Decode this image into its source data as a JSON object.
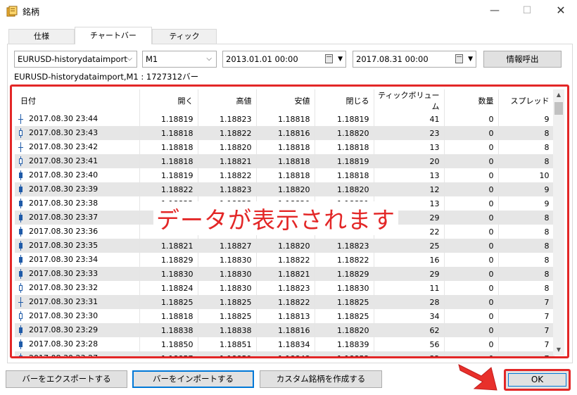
{
  "window": {
    "title": "銘柄",
    "minimize": "—",
    "maximize": "☐",
    "close": "✕"
  },
  "tabs": [
    "仕様",
    "チャートバー",
    "ティック"
  ],
  "controls": {
    "symbol": "EURUSD-historydataimport",
    "timeframe": "M1",
    "date_from": "2013.01.01 00:00",
    "date_to": "2017.08.31 00:00",
    "request_button": "情報呼出"
  },
  "info_line": "EURUSD-historydataimport,M1 : 1727312バー",
  "table": {
    "headers": [
      "日付",
      "開く",
      "高値",
      "安値",
      "閉じる",
      "ティックボリューム",
      "数量",
      "スプレッド"
    ],
    "rows": [
      [
        "2017.08.30 23:44",
        "1.18819",
        "1.18823",
        "1.18818",
        "1.18819",
        "41",
        "0",
        "9"
      ],
      [
        "2017.08.30 23:43",
        "1.18818",
        "1.18822",
        "1.18816",
        "1.18820",
        "23",
        "0",
        "8"
      ],
      [
        "2017.08.30 23:42",
        "1.18818",
        "1.18820",
        "1.18818",
        "1.18818",
        "13",
        "0",
        "8"
      ],
      [
        "2017.08.30 23:41",
        "1.18818",
        "1.18821",
        "1.18818",
        "1.18819",
        "20",
        "0",
        "8"
      ],
      [
        "2017.08.30 23:40",
        "1.18819",
        "1.18822",
        "1.18818",
        "1.18818",
        "13",
        "0",
        "10"
      ],
      [
        "2017.08.30 23:39",
        "1.18822",
        "1.18823",
        "1.18820",
        "1.18820",
        "12",
        "0",
        "9"
      ],
      [
        "2017.08.30 23:38",
        "1.18822",
        "1.18823",
        "1.18820",
        "1.18821",
        "13",
        "0",
        "9"
      ],
      [
        "2017.08.30 23:37",
        "1.18824",
        "",
        "",
        "",
        "29",
        "0",
        "8"
      ],
      [
        "2017.08.30 23:36",
        "1.18824",
        "",
        "",
        "",
        "22",
        "0",
        "8"
      ],
      [
        "2017.08.30 23:35",
        "1.18821",
        "1.18827",
        "1.18820",
        "1.18823",
        "25",
        "0",
        "8"
      ],
      [
        "2017.08.30 23:34",
        "1.18829",
        "1.18830",
        "1.18822",
        "1.18822",
        "16",
        "0",
        "8"
      ],
      [
        "2017.08.30 23:33",
        "1.18830",
        "1.18830",
        "1.18821",
        "1.18829",
        "29",
        "0",
        "8"
      ],
      [
        "2017.08.30 23:32",
        "1.18824",
        "1.18830",
        "1.18823",
        "1.18830",
        "11",
        "0",
        "8"
      ],
      [
        "2017.08.30 23:31",
        "1.18825",
        "1.18825",
        "1.18822",
        "1.18825",
        "28",
        "0",
        "7"
      ],
      [
        "2017.08.30 23:30",
        "1.18818",
        "1.18825",
        "1.18813",
        "1.18825",
        "34",
        "0",
        "7"
      ],
      [
        "2017.08.30 23:29",
        "1.18838",
        "1.18838",
        "1.18816",
        "1.18820",
        "62",
        "0",
        "7"
      ],
      [
        "2017.08.30 23:28",
        "1.18850",
        "1.18851",
        "1.18834",
        "1.18839",
        "56",
        "0",
        "7"
      ],
      [
        "2017.08.30 23:27",
        "1.18857",
        "1.18859",
        "1.18848",
        "1.18852",
        "32",
        "0",
        "7"
      ]
    ],
    "candles": [
      "doji",
      "hollow",
      "doji",
      "hollow",
      "fill",
      "fill",
      "fill",
      "fill",
      "fill",
      "fill",
      "fill",
      "fill",
      "hollow",
      "doji",
      "hollow",
      "fill",
      "fill",
      "fill"
    ]
  },
  "overlay_text": "データが表示されます",
  "buttons": {
    "export": "バーをエクスポートする",
    "import": "バーをインポートする",
    "custom": "カスタム銘柄を作成する",
    "ok": "OK"
  },
  "colors": {
    "highlight": "#e32727",
    "focus": "#0078d7",
    "candle": "#1e5aa8",
    "row_alt": "#e6e6e6"
  }
}
